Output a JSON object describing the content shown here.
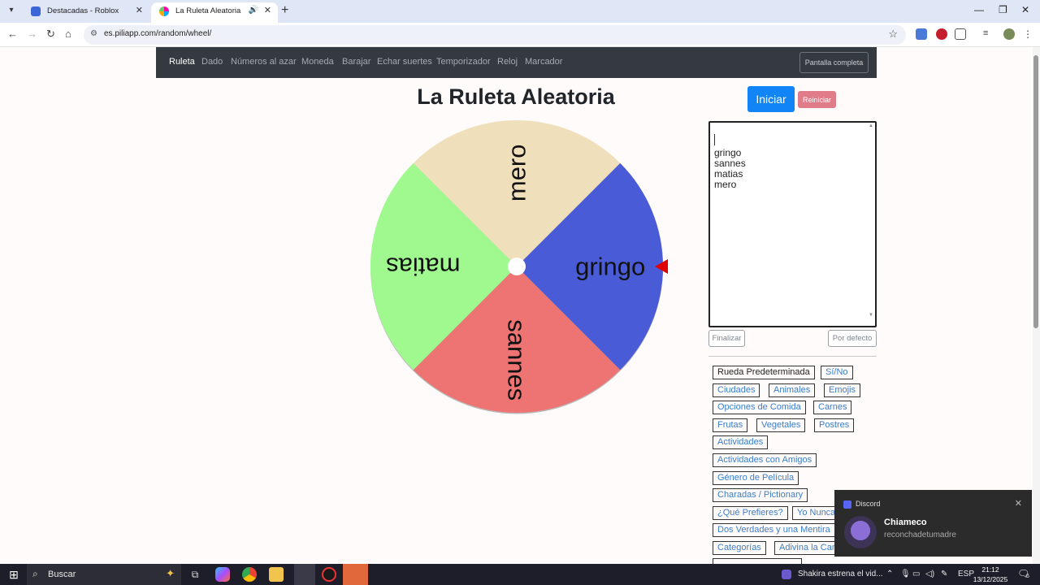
{
  "browser": {
    "tabs": [
      {
        "title": "Destacadas - Roblox",
        "active": false
      },
      {
        "title": "La Ruleta Aleatoria",
        "active": true
      }
    ],
    "url": "es.piliapp.com/random/wheel/"
  },
  "site": {
    "nav": [
      "Ruleta",
      "Dado",
      "Números al azar",
      "Moneda",
      "Barajar",
      "Echar suertes",
      "Temporizador",
      "Reloj",
      "Marcador"
    ],
    "fullscreen_label": "Pantalla completa",
    "title": "La Ruleta Aleatoria",
    "start_label": "Iniciar",
    "reset_label": "Reiniciar"
  },
  "wheel": {
    "segments": [
      {
        "label": "gringo",
        "color": "#4a5bd8"
      },
      {
        "label": "sannes",
        "color": "#ee7373"
      },
      {
        "label": "matias",
        "color": "#9ff98f"
      },
      {
        "label": "mero",
        "color": "#f0dfbb"
      }
    ],
    "pointer_color": "#e00000"
  },
  "names_box": {
    "lines": [
      "gringo",
      "sannes",
      "matias",
      "mero"
    ]
  },
  "buttons": {
    "finish": "Finalizar",
    "default": "Por defecto"
  },
  "presets": [
    "Rueda Predeterminada",
    "Sí/No",
    "Ciudades",
    "Animales",
    "Emojis",
    "Opciones de Comida",
    "Carnes",
    "Frutas",
    "Vegetales",
    "Postres",
    "Actividades",
    "Actividades con Amigos",
    "Género de Película",
    "Charadas / Pictionary",
    "¿Qué Prefieres?",
    "Yo Nunca",
    "Dos Verdades y una Mentira",
    "Categorías",
    "Adivina la Can"
  ],
  "toast": {
    "app": "Discord",
    "sender": "Chiameco",
    "message": "reconchadetumadre"
  },
  "taskbar": {
    "search": "Buscar",
    "media": "Shakira estrena el vid...",
    "lang": "ESP",
    "time": "21:12",
    "date": "13/12/2025",
    "notif_count": "6"
  }
}
